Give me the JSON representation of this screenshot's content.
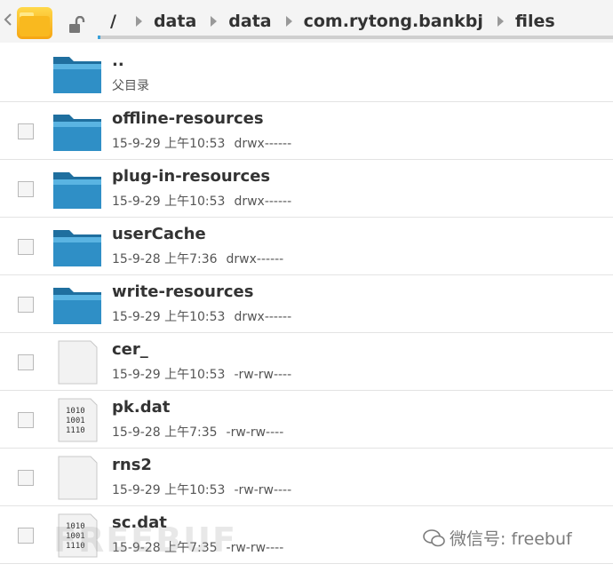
{
  "breadcrumb": {
    "root": "/",
    "items": [
      "data",
      "data",
      "com.rytong.bankbj",
      "files"
    ]
  },
  "colors": {
    "folder": "#2f8fc6",
    "accent": "#3aa0d8"
  },
  "progress_fraction": 0.005,
  "files": [
    {
      "name": "..",
      "date": "",
      "perm": "",
      "sub": "父目录",
      "icon": "folder-icon"
    },
    {
      "name": "offline-resources",
      "date": "15-9-29 上午10:53",
      "perm": "drwx------",
      "icon": "folder-icon"
    },
    {
      "name": "plug-in-resources",
      "date": "15-9-29 上午10:53",
      "perm": "drwx------",
      "icon": "folder-icon"
    },
    {
      "name": "userCache",
      "date": "15-9-28 上午7:36",
      "perm": "drwx------",
      "icon": "folder-icon"
    },
    {
      "name": "write-resources",
      "date": "15-9-29 上午10:53",
      "perm": "drwx------",
      "icon": "folder-icon"
    },
    {
      "name": "cer_",
      "date": "15-9-29 上午10:53",
      "perm": "-rw-rw----",
      "icon": "blank-file-icon"
    },
    {
      "name": "pk.dat",
      "date": "15-9-28 上午7:35",
      "perm": "-rw-rw----",
      "icon": "binary-file-icon"
    },
    {
      "name": "rns2",
      "date": "15-9-29 上午10:53",
      "perm": "-rw-rw----",
      "icon": "blank-file-icon"
    },
    {
      "name": "sc.dat",
      "date": "15-9-28 上午7:35",
      "perm": "-rw-rw----",
      "icon": "binary-file-icon"
    }
  ],
  "binary_label": [
    "1010",
    "1001",
    "1110"
  ],
  "watermark": {
    "text": "微信号: freebuf",
    "logo": "FREEBUF"
  }
}
